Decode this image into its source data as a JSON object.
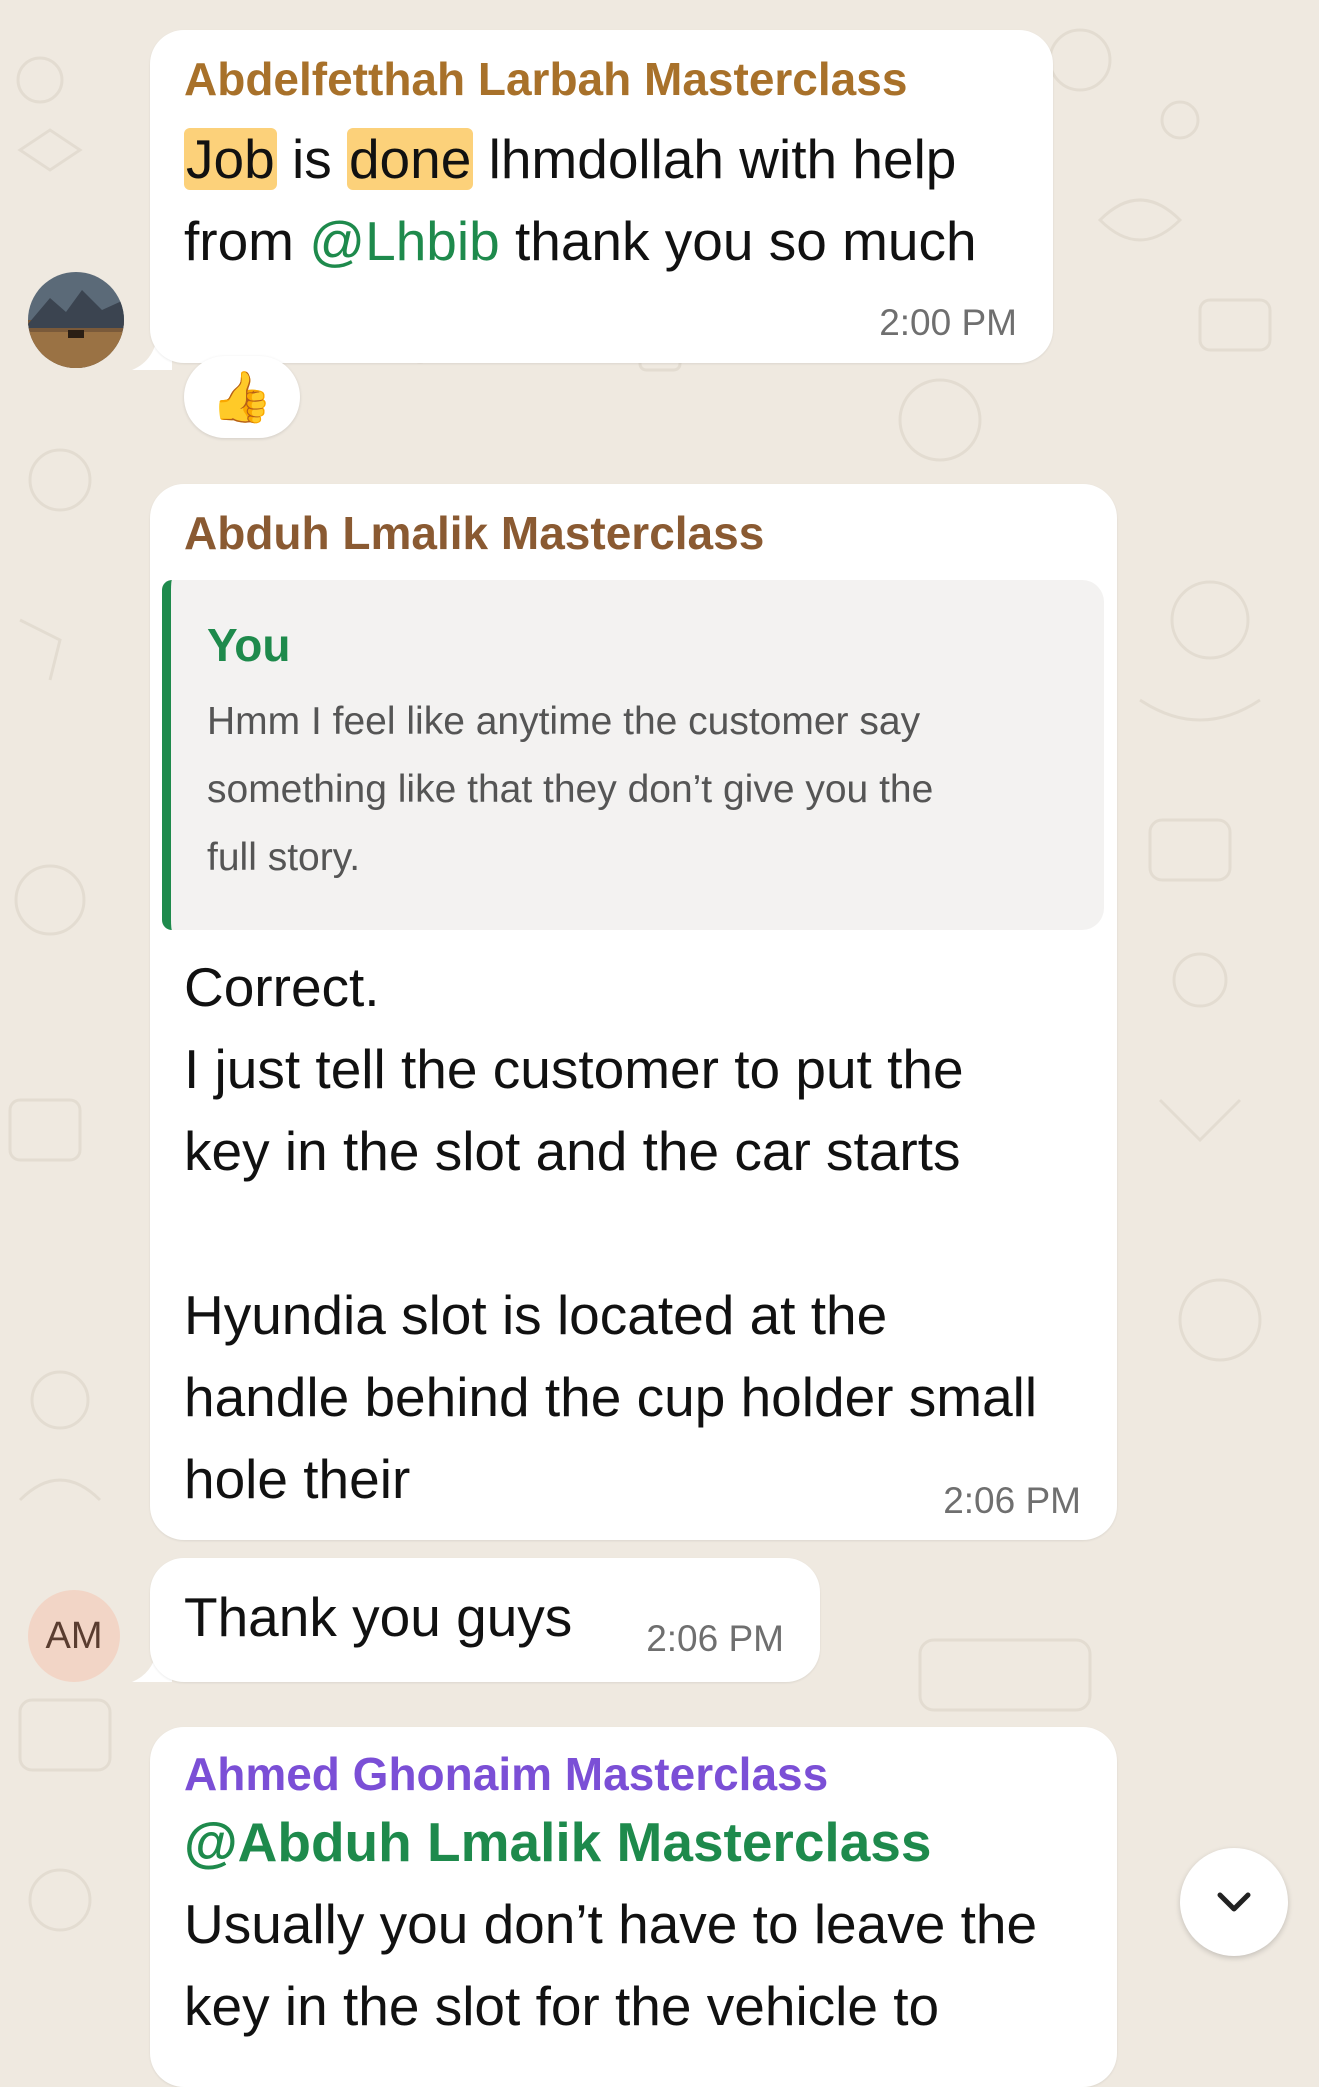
{
  "colors": {
    "wallpaper": "#efe9e0",
    "bubble": "#ffffff",
    "sender_larbah": "#a8712a",
    "sender_lmalik": "#8a5a32",
    "sender_ghonaim": "#7b4fd6",
    "mention": "#1e8a4c",
    "highlight": "#fcd17a",
    "quote_bar": "#1e8a4c",
    "time": "#6f6f6f"
  },
  "messages": [
    {
      "sender": "Abdelfetthah Larbah Masterclass",
      "hl1": "Job",
      "t1": " is ",
      "hl2": "done",
      "t2": " lhmdollah with help",
      "line2_prefix": "from ",
      "mention": "@Lhbib",
      "line2_suffix": " thank you so much",
      "time": "2:00 PM",
      "reaction": "👍",
      "avatar_icon": "landscape-avatar-icon"
    },
    {
      "sender": "Abduh Lmalik Masterclass",
      "quote": {
        "author": "You",
        "lines": [
          "Hmm I feel like anytime the customer say",
          "something like that they don’t give you the",
          "full story."
        ]
      },
      "lines": [
        "Correct.",
        "I just tell the customer to put the",
        "key in the slot and the car starts",
        "",
        "Hyundia slot is located at the",
        "handle behind the cup holder small",
        "hole their"
      ],
      "time": "2:06 PM"
    },
    {
      "text": "Thank you guys",
      "time": "2:06 PM",
      "avatar_initials": "AM"
    },
    {
      "sender": "Ahmed Ghonaim Masterclass",
      "mention": "@Abduh Lmalik Masterclass",
      "lines": [
        "Usually you don’t have to leave the",
        "key in the slot for the vehicle to"
      ]
    }
  ],
  "scroll_button_icon": "chevron-down-icon"
}
